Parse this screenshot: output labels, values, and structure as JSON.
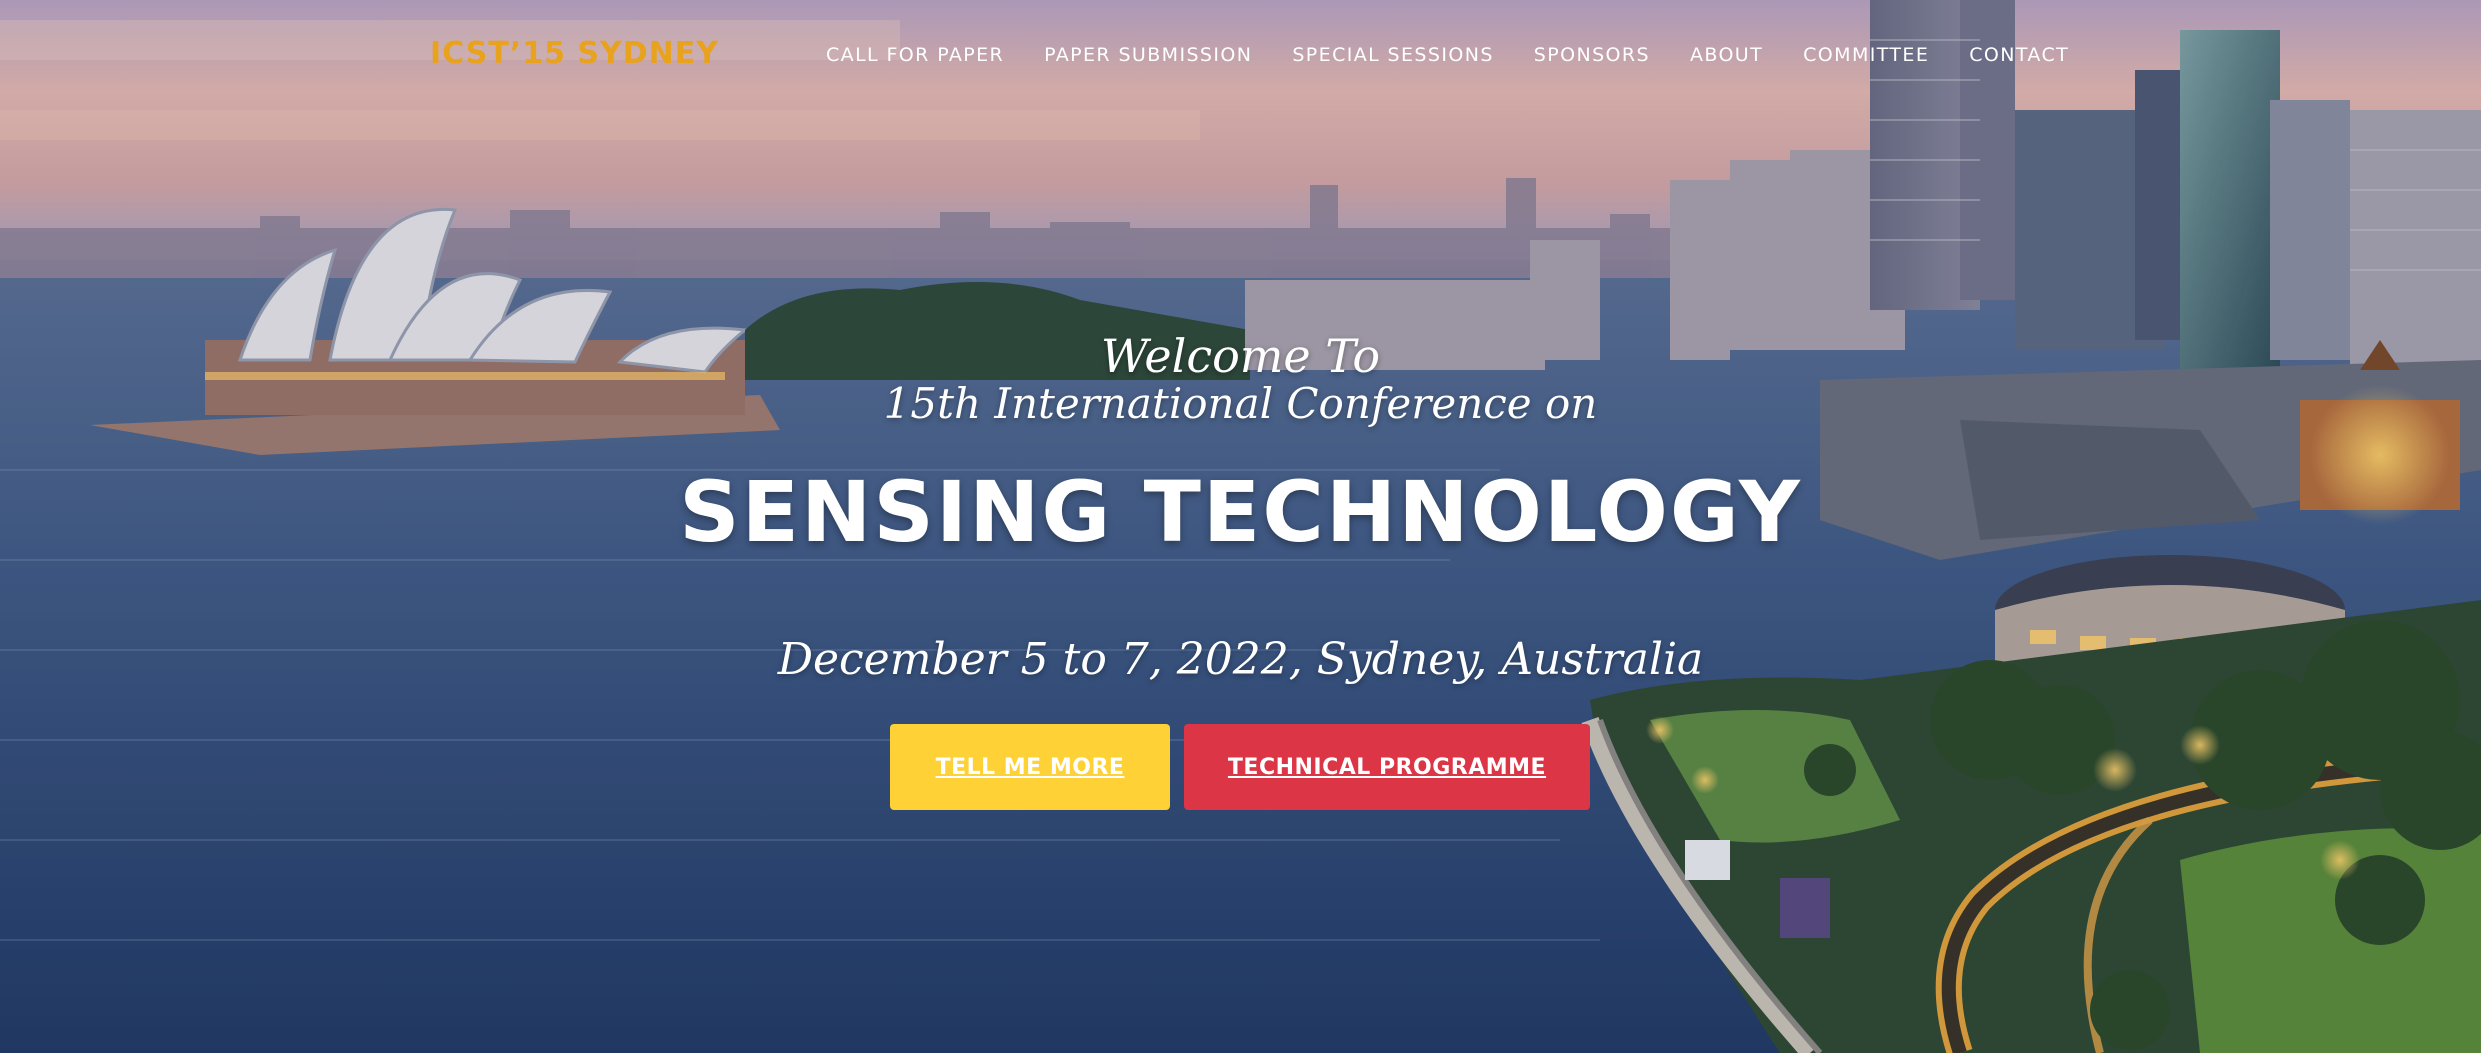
{
  "brand": {
    "title": "ICST’15 SYDNEY",
    "color": "#e8a21d"
  },
  "nav": {
    "items": [
      {
        "label": "CALL FOR PAPER"
      },
      {
        "label": "PAPER SUBMISSION"
      },
      {
        "label": "SPECIAL SESSIONS"
      },
      {
        "label": "SPONSORS"
      },
      {
        "label": "ABOUT"
      },
      {
        "label": "COMMITTEE"
      },
      {
        "label": "CONTACT"
      }
    ]
  },
  "hero": {
    "welcome": "Welcome To",
    "conference": "15th International Conference on",
    "headline": "SENSING TECHNOLOGY",
    "dateline": "December 5 to 7, 2022, Sydney, Australia",
    "background": "Sydney Harbour skyline with Opera House at dusk"
  },
  "buttons": {
    "more": {
      "label": "TELL ME MORE",
      "color": "#fed136"
    },
    "programme": {
      "label": "TECHNICAL PROGRAMME",
      "color": "#dc3545"
    }
  }
}
